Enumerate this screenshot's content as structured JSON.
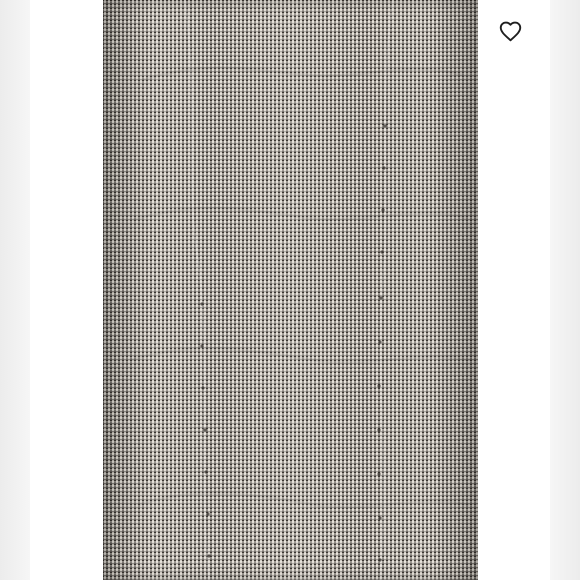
{
  "product": {
    "image_description_icon": "knit-fabric-photo"
  },
  "actions": {
    "favorite_icon": "heart-outline-icon",
    "favorite_color": "#1f1f1f",
    "favorite_state": "not-liked"
  },
  "colors": {
    "background": "#ffffff",
    "side_strip": "#efefef",
    "fabric_light": "#e9e4dc",
    "fabric_dark": "#2f2b27"
  }
}
